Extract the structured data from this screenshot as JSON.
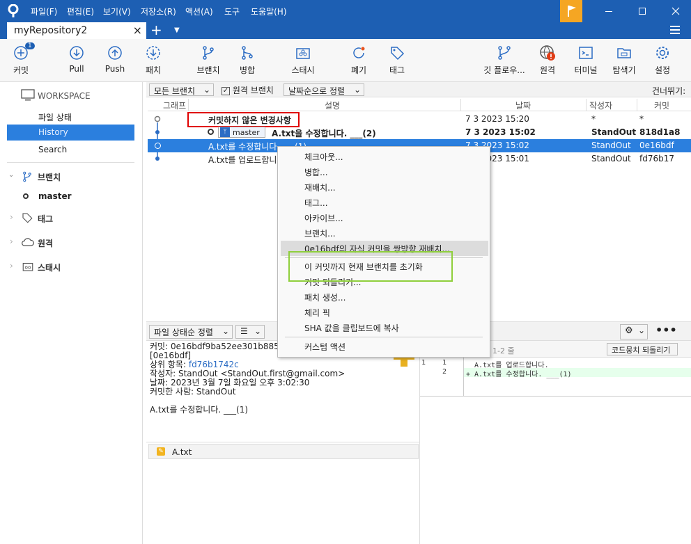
{
  "menus": [
    "파일(F)",
    "편집(E)",
    "보기(V)",
    "저장소(R)",
    "액션(A)",
    "도구",
    "도움말(H)"
  ],
  "tab": {
    "title": "myRepository2"
  },
  "toolbar": {
    "commit": "커밋",
    "commit_badge": "1",
    "pull": "Pull",
    "push": "Push",
    "fetch": "패치",
    "branch": "브랜치",
    "merge": "병합",
    "stash": "스태시",
    "discard": "폐기",
    "tag": "태그",
    "gitflow": "깃 플로우...",
    "remote": "원격",
    "terminal": "터미널",
    "explorer": "탐색기",
    "settings": "설정"
  },
  "sidebar": {
    "workspace": "WORKSPACE",
    "file_status": "파일 상태",
    "history": "History",
    "search": "Search",
    "branches": "브랜치",
    "master": "master",
    "tags": "태그",
    "remotes": "원격",
    "stashes": "스태시"
  },
  "filter": {
    "all_branches": "모든 브랜치",
    "remote_branches": "원격 브랜치",
    "sort_by_date": "날짜순으로 정렬",
    "jump_to": "건너뛰기:"
  },
  "columns": {
    "graph": "그래프",
    "description": "설명",
    "date": "날짜",
    "author": "작성자",
    "commit": "커밋"
  },
  "rows": [
    {
      "desc": "커밋하지 않은 변경사항",
      "date": "7 3 2023 15:20",
      "author": "*",
      "commit": "*"
    },
    {
      "branch": "master",
      "desc": "A.txt을 수정합니다. ___(2)",
      "date": "7 3 2023 15:02",
      "author": "StandOut",
      "commit": "818d1a8"
    },
    {
      "desc": "A.txt를 수정합니다. ___(1)",
      "date": "7 3 2023 15:02",
      "author": "StandOut",
      "commit": "0e16bdf"
    },
    {
      "desc": "A.txt를 업로드합니다.",
      "date": "7 3 2023 15:01",
      "author": "StandOut",
      "commit": "fd76b17"
    }
  ],
  "context_menu": [
    "체크아웃...",
    "병합...",
    "재배치...",
    "태그...",
    "아카이브...",
    "브랜치...",
    "0e16bdf의 자식 커밋을 쌍방향 재배치...",
    "이 커밋까지 현재 브랜치를 초기화",
    "커밋 되돌리기...",
    "패치 생성...",
    "체리 픽",
    "SHA 값을 클립보드에 복사",
    "커스텀 액션"
  ],
  "bottom": {
    "sort_file_status": "파일 상태순 정렬",
    "revert_hunk": "코드뭉치 되돌리기",
    "hunk_label": "1-2 줄"
  },
  "details": {
    "commit_line": "커밋: 0e16bdf9ba52ee301b8850",
    "short_sha": "[0e16bdf]",
    "parent_label": "상위 항목: ",
    "parent_sha": "fd76b1742c",
    "author_line": "작성자: StandOut <StandOut.first@gmail.com>",
    "date_line": "날짜: 2023년 3월 7일 화요일 오후 3:02:30",
    "committer_line": "커밋한 사람: StandOut",
    "message": "A.txt를 수정합니다. ___(1)"
  },
  "files": [
    "A.txt"
  ],
  "diff": [
    {
      "old": "1",
      "new": "1",
      "text": "  A.txt를 업로드합니다."
    },
    {
      "old": "",
      "new": "2",
      "text": "+ A.txt를 수정합니다. ___(1)"
    }
  ],
  "colors": {
    "titlebar": "#1d5fb3",
    "selection": "#2b7fde",
    "accent_red": "#e00000",
    "accent_green": "#8fcf3c",
    "flag": "#f5a623",
    "added_line": "#e6ffec"
  }
}
